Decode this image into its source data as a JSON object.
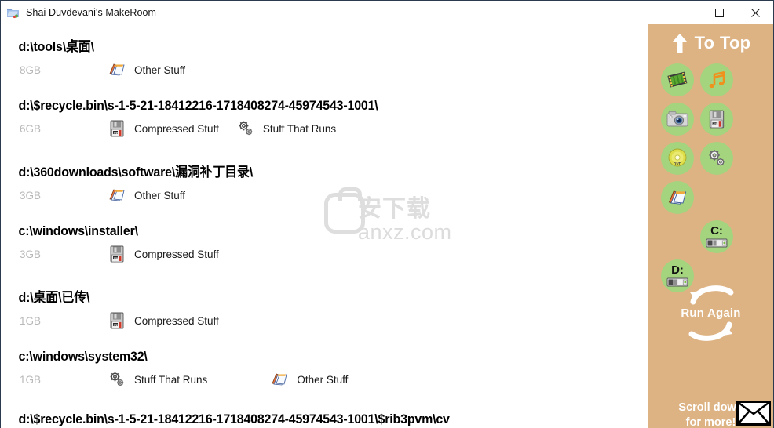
{
  "window": {
    "title": "Shai Duvdevani's MakeRoom",
    "icon": "folder-icon",
    "controls": {
      "minimize": "minimize-button",
      "maximize": "maximize-button",
      "close": "close-button"
    }
  },
  "colors": {
    "sidebar_bg": "#ddb384",
    "icon_circle": "#a4d47e",
    "size_text": "#b8b8b8",
    "path_text": "#000000",
    "sidebar_text": "#ffffff",
    "window_bg": "#ffffff",
    "window_border": "#2b3b4d"
  },
  "list": {
    "entries": [
      {
        "path": "d:\\tools\\桌面\\",
        "size": "8GB",
        "tags": [
          {
            "label": "Other Stuff",
            "icon": "documents-icon"
          }
        ]
      },
      {
        "path": "d:\\$recycle.bin\\s-1-5-21-18412216-1718408274-45974543-1001\\",
        "size": "6GB",
        "tags": [
          {
            "label": "Compressed Stuff",
            "icon": "zip-disk-icon"
          },
          {
            "label": "Stuff That Runs",
            "icon": "gears-icon"
          }
        ]
      },
      {
        "path": "d:\\360downloads\\software\\漏洞补丁目录\\",
        "size": "3GB",
        "tags": [
          {
            "label": "Other Stuff",
            "icon": "documents-icon"
          }
        ]
      },
      {
        "path": "c:\\windows\\installer\\",
        "size": "3GB",
        "tags": [
          {
            "label": "Compressed Stuff",
            "icon": "zip-disk-icon"
          }
        ]
      },
      {
        "path": "d:\\桌面\\已传\\",
        "size": "1GB",
        "tags": [
          {
            "label": "Compressed Stuff",
            "icon": "zip-disk-icon"
          }
        ]
      },
      {
        "path": "c:\\windows\\system32\\",
        "size": "1GB",
        "tags": [
          {
            "label": "Stuff That Runs",
            "icon": "gears-icon"
          },
          {
            "label": "Other Stuff",
            "icon": "documents-icon"
          }
        ]
      },
      {
        "path": "d:\\$recycle.bin\\s-1-5-21-18412216-1718408274-45974543-1001\\$rib3pvm\\cv",
        "size": "",
        "tags": []
      }
    ]
  },
  "sidebar": {
    "to_top_label": "To Top",
    "to_top_icon": "up-arrow-icon",
    "filters": [
      {
        "name": "video-filter",
        "icon": "film-strip-icon"
      },
      {
        "name": "music-filter",
        "icon": "music-note-icon"
      },
      {
        "name": "pictures-filter",
        "icon": "camera-icon"
      },
      {
        "name": "compressed-filter",
        "icon": "zip-disk-icon"
      },
      {
        "name": "disc-images-filter",
        "icon": "dvd-icon"
      },
      {
        "name": "programs-filter",
        "icon": "gears-icon"
      },
      {
        "name": "other-filter",
        "icon": "documents-icon"
      },
      {
        "name": "drive-c-filter",
        "icon": "hard-drive-icon",
        "label": "C:"
      },
      {
        "name": "drive-d-filter",
        "icon": "hard-drive-icon",
        "label": "D:"
      }
    ],
    "run_again_label": "Run Again",
    "run_again_icon": "refresh-arrows-icon",
    "scroll_down_line1": "Scroll down",
    "scroll_down_line2": "for more!",
    "mail_icon": "envelope-icon"
  },
  "watermark": {
    "text": "安下载",
    "subtext": "anxz.com"
  }
}
